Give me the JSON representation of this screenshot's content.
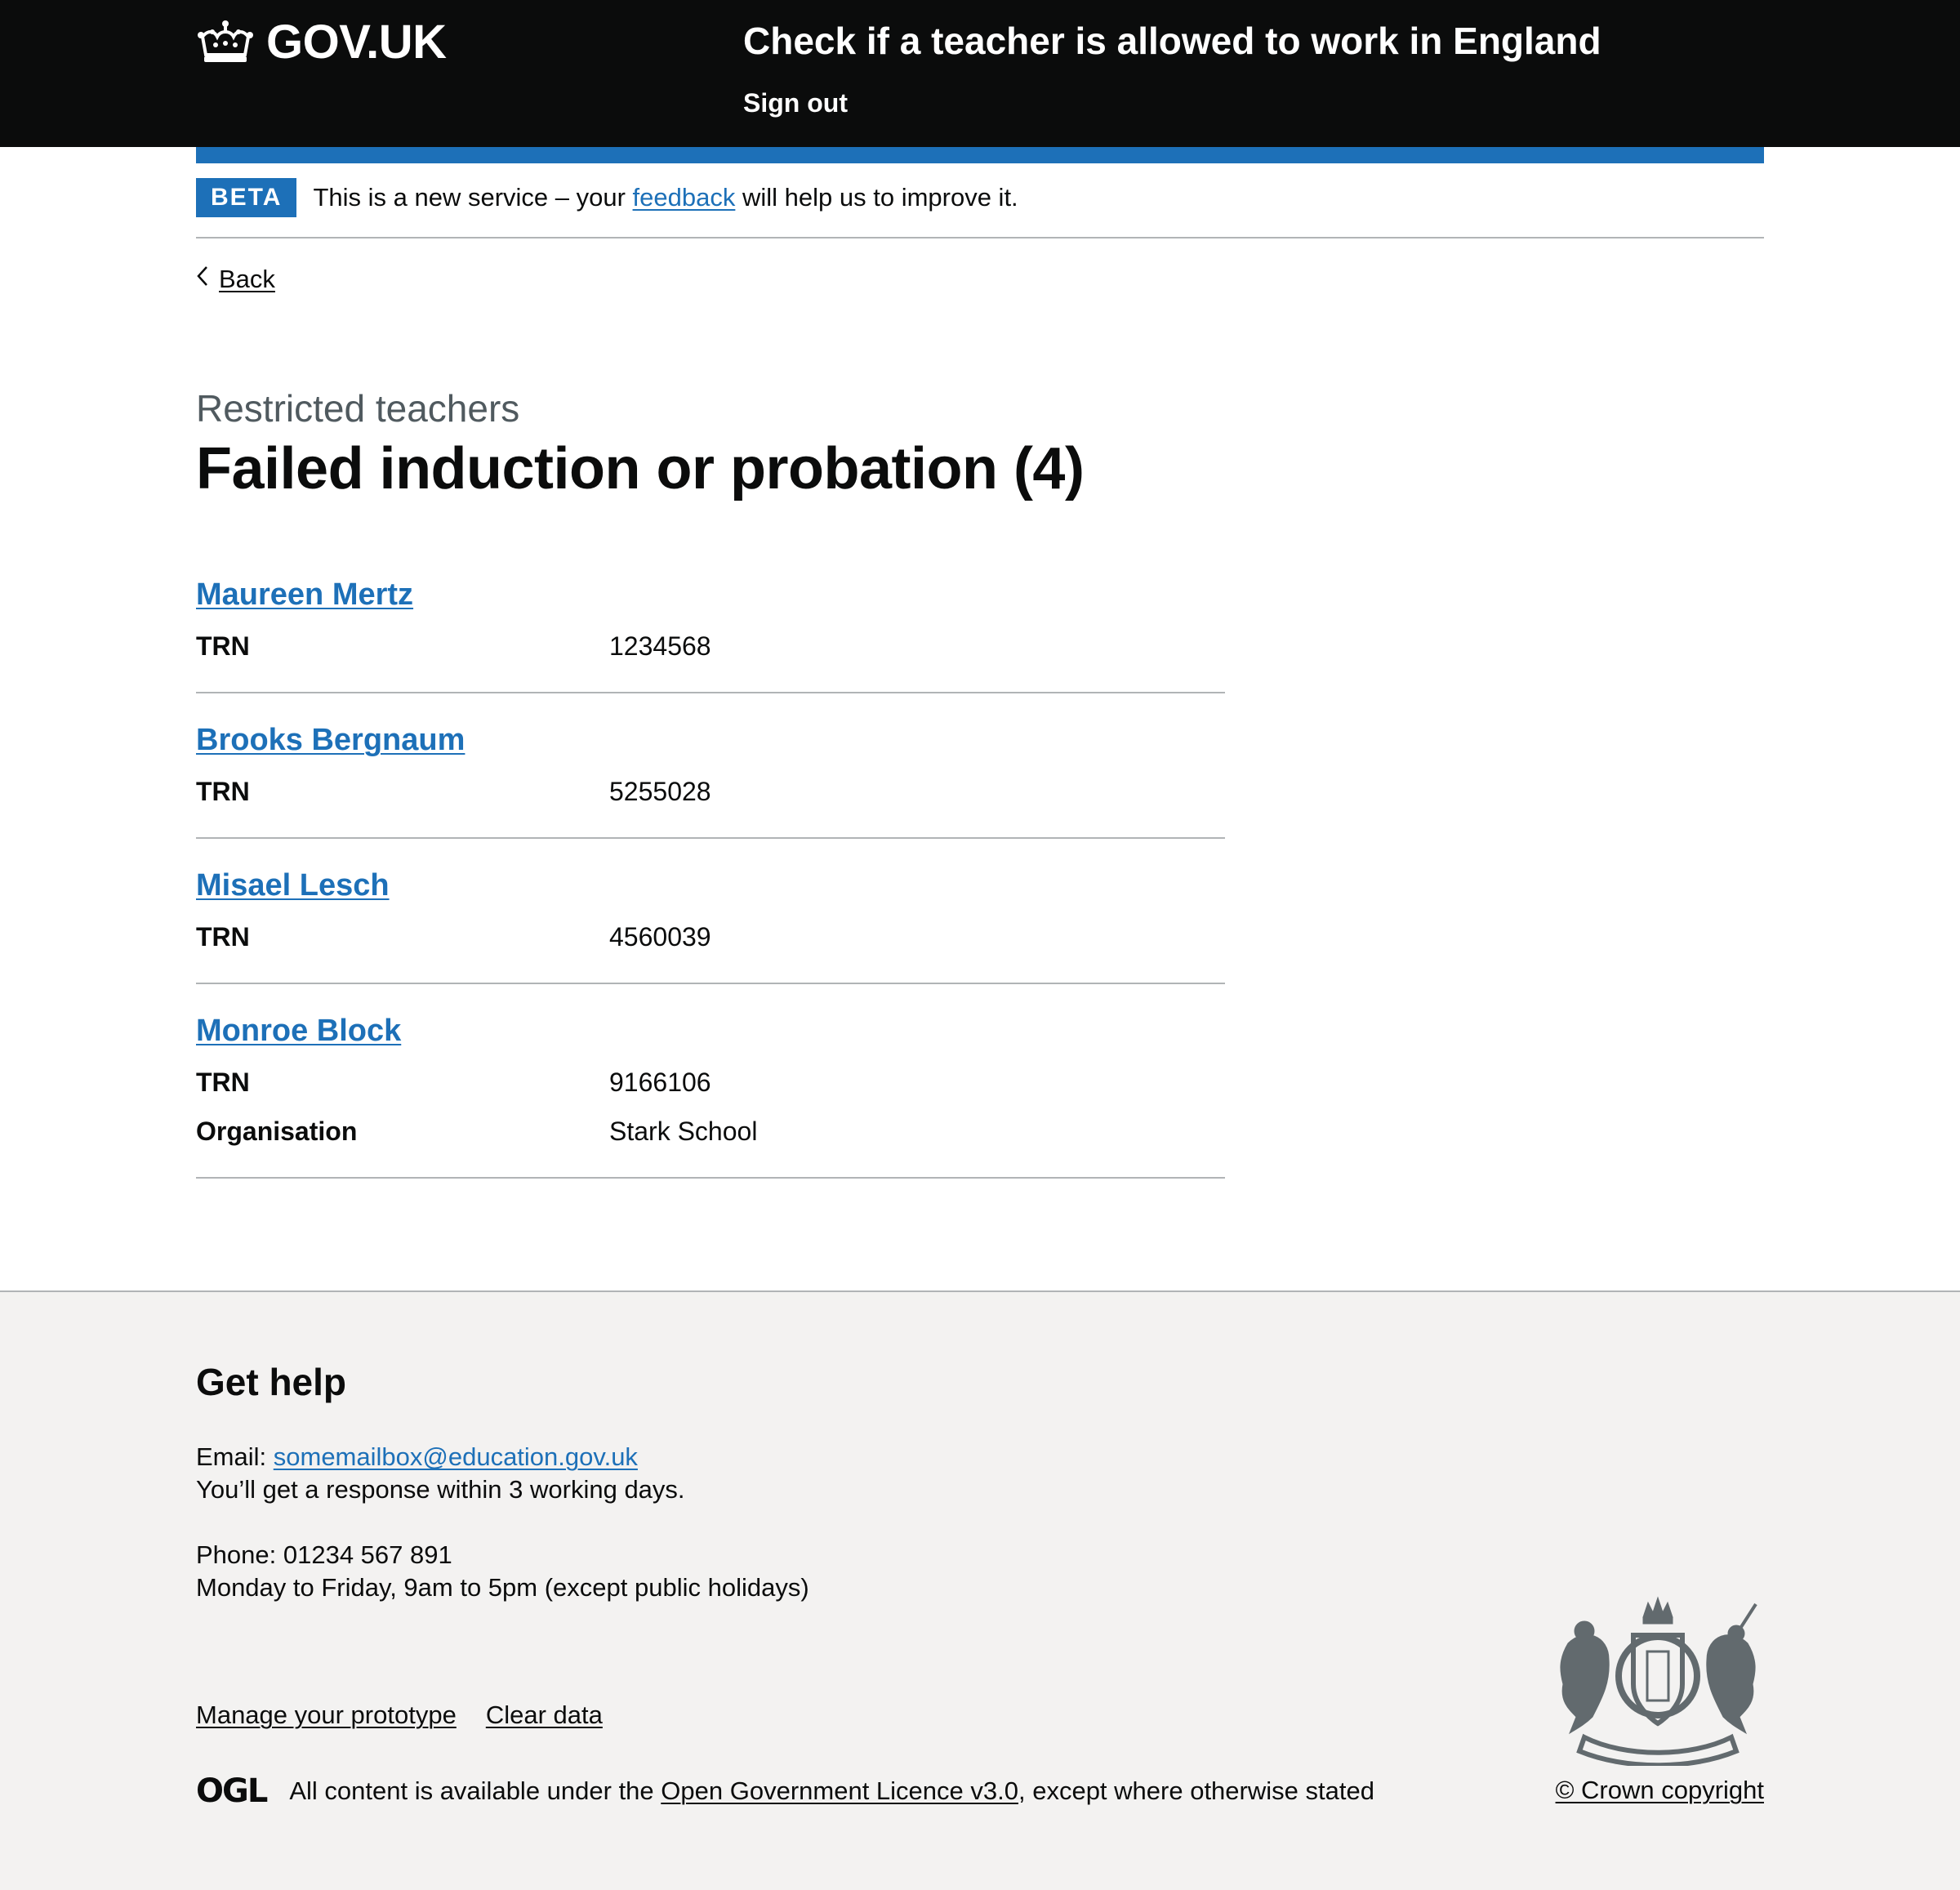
{
  "header": {
    "logo_text": "GOV.UK",
    "service_name": "Check if a teacher is allowed to work in England",
    "sign_out_label": "Sign out"
  },
  "phase_banner": {
    "tag": "BETA",
    "text_before": "This is a new service – your ",
    "link_text": "feedback",
    "text_after": " will help us to improve it."
  },
  "back_link": {
    "label": "Back"
  },
  "page": {
    "caption": "Restricted teachers",
    "title": "Failed induction or probation (4)"
  },
  "records": [
    {
      "name": "Maureen Mertz",
      "fields": [
        {
          "key": "TRN",
          "value": "1234568"
        }
      ]
    },
    {
      "name": "Brooks Bergnaum",
      "fields": [
        {
          "key": "TRN",
          "value": "5255028"
        }
      ]
    },
    {
      "name": "Misael Lesch",
      "fields": [
        {
          "key": "TRN",
          "value": "4560039"
        }
      ]
    },
    {
      "name": "Monroe Block",
      "fields": [
        {
          "key": "TRN",
          "value": "9166106"
        },
        {
          "key": "Organisation",
          "value": "Stark School"
        }
      ]
    }
  ],
  "footer": {
    "help_title": "Get help",
    "email_label": "Email: ",
    "email": "somemailbox@education.gov.uk",
    "email_response": "You’ll get a response within 3 working days.",
    "phone": "Phone: 01234 567 891",
    "hours": "Monday to Friday, 9am to 5pm (except public holidays)",
    "links": [
      "Manage your prototype",
      "Clear data"
    ],
    "ogl_logo": "OGL",
    "licence_before": "All content is available under the ",
    "licence_link": "Open Government Licence v3.0",
    "licence_after": ", except where otherwise stated",
    "copyright": "© Crown copyright",
    "crest_icon": "royal-coat-of-arms-icon"
  },
  "colors": {
    "header_bg": "#0b0c0c",
    "brand_blue": "#1d70b8",
    "footer_bg": "#f3f2f1",
    "secondary_text": "#505a5f",
    "border": "#b1b4b6"
  }
}
